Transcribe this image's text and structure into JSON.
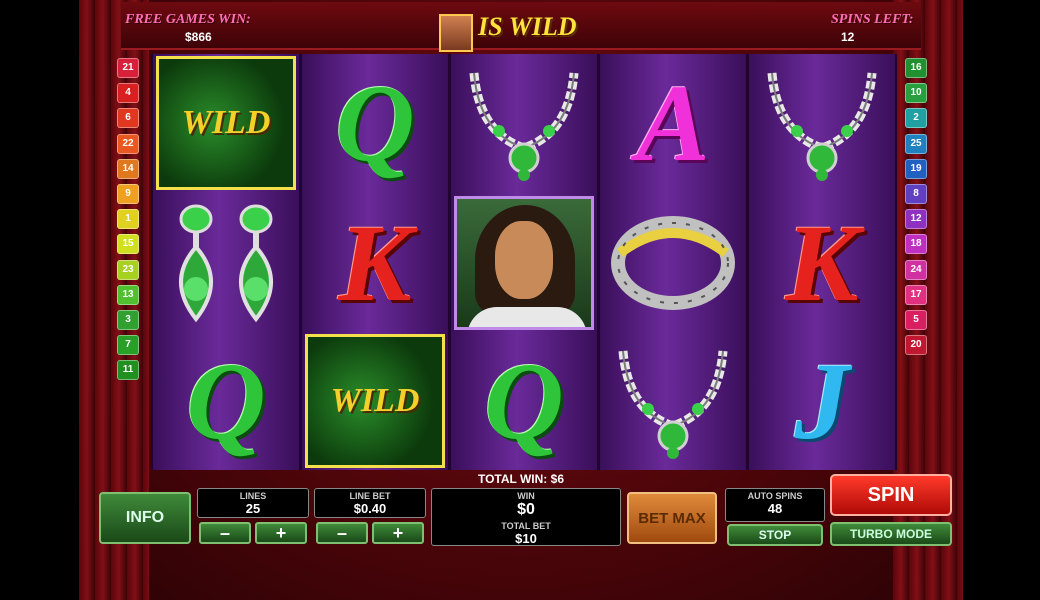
{
  "header": {
    "free_games_label": "FREE GAMES WIN:",
    "free_games_value": "$866",
    "wild_title": "IS WILD",
    "spins_left_label": "SPINS LEFT:",
    "spins_left_value": "12"
  },
  "paylines_left": [
    "21",
    "4",
    "6",
    "22",
    "14",
    "9",
    "1",
    "15",
    "23",
    "13",
    "3",
    "7",
    "11"
  ],
  "paylines_right": [
    "16",
    "10",
    "2",
    "25",
    "19",
    "8",
    "12",
    "18",
    "24",
    "17",
    "5",
    "20"
  ],
  "payline_colors_left": [
    "#d8203a",
    "#d82020",
    "#e03820",
    "#e85820",
    "#e07820",
    "#f0a020",
    "#e0d020",
    "#d0e020",
    "#a8d020",
    "#50c030",
    "#30a030",
    "#28a028",
    "#209020"
  ],
  "payline_colors_right": [
    "#209030",
    "#28a040",
    "#20a0a0",
    "#2080c0",
    "#2060c0",
    "#6040c0",
    "#9030c0",
    "#c030c0",
    "#d030a0",
    "#e03080",
    "#d82060",
    "#c01830"
  ],
  "reels": [
    [
      "WILD",
      "earrings",
      "Q"
    ],
    [
      "Q",
      "K",
      "WILD"
    ],
    [
      "necklace",
      "portrait",
      "Q"
    ],
    [
      "A",
      "bracelet",
      "necklace"
    ],
    [
      "necklace",
      "K",
      "J"
    ]
  ],
  "total_win": "TOTAL WIN: $6",
  "controls": {
    "info": "INFO",
    "lines_label": "LINES",
    "lines_value": "25",
    "minus": "–",
    "plus": "+",
    "line_bet_label": "LINE BET",
    "line_bet_value": "$0.40",
    "win_label": "WIN",
    "win_value": "$0",
    "total_bet_label": "TOTAL BET",
    "total_bet_value": "$10",
    "bet_max": "BET MAX",
    "auto_spins_label": "AUTO SPINS",
    "auto_spins_value": "48",
    "stop": "STOP",
    "spin": "SPIN",
    "turbo": "TURBO MODE"
  }
}
